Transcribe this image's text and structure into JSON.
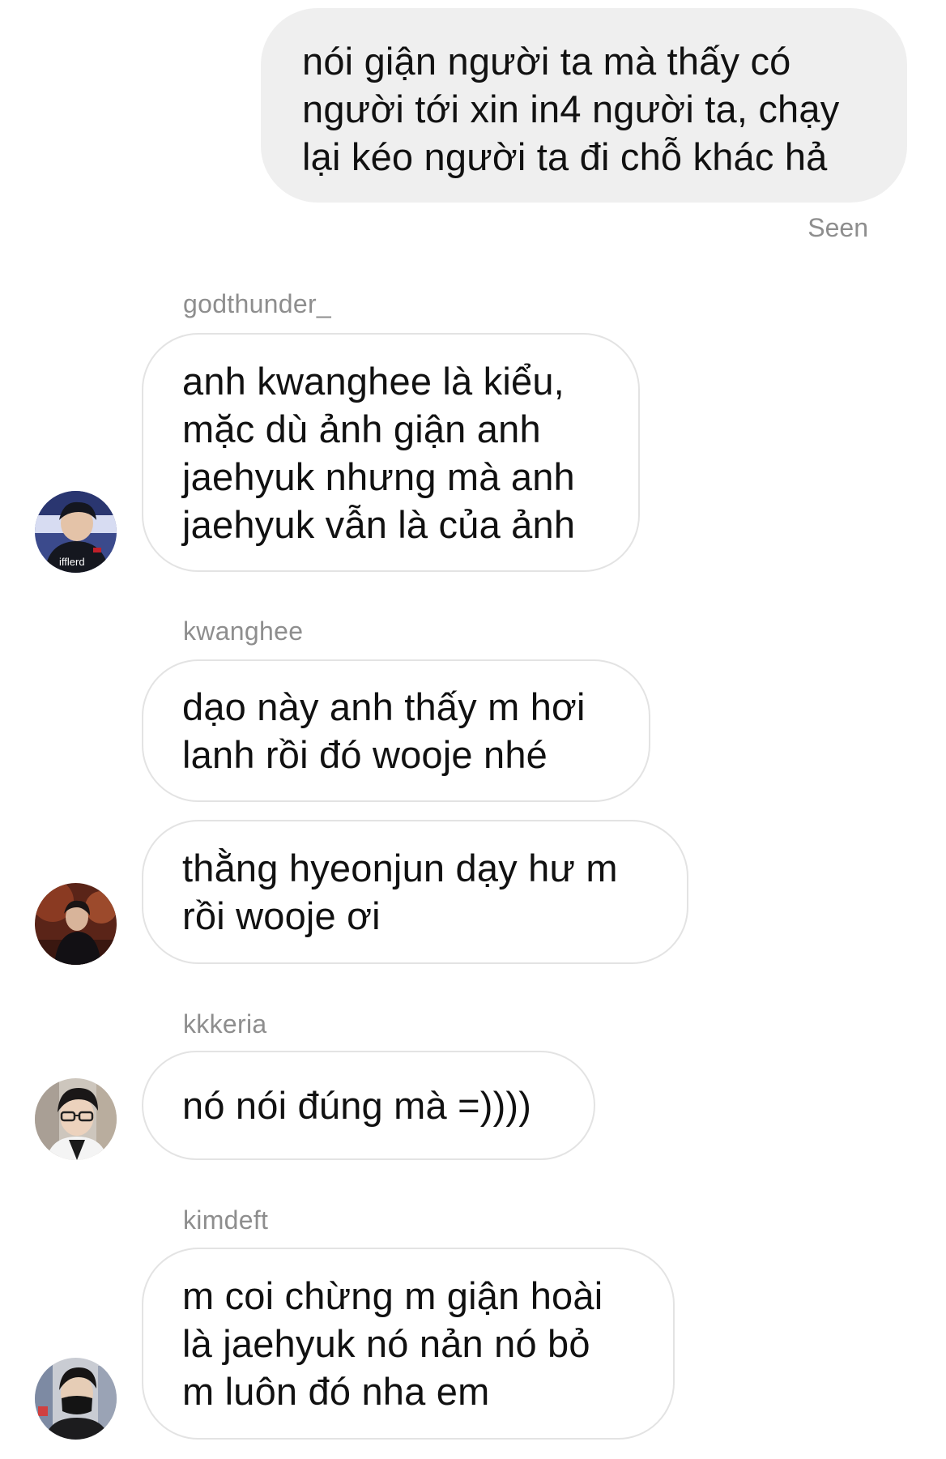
{
  "conversation": {
    "outgoing": {
      "text": "nói giận người ta mà thấy có\nngười tới xin in4 người ta, chạy\nlại kéo người ta đi chỗ khác hả",
      "status": "Seen"
    },
    "groups": [
      {
        "sender": "godthunder_",
        "avatar_icon": "avatar-godthunder-photo",
        "messages": [
          "anh kwanghee là kiểu,\nmặc dù ảnh giận anh\njaehyuk nhưng mà anh\njaehyuk vẫn là của ảnh"
        ],
        "avatar_badge": "ifflerd"
      },
      {
        "sender": "kwanghee",
        "avatar_icon": "avatar-kwanghee-photo",
        "messages": [
          "dạo này anh thấy m hơi\nlanh rồi đó wooje nhé",
          "thằng hyeonjun dạy hư m\nrồi wooje ơi"
        ]
      },
      {
        "sender": "kkkeria",
        "avatar_icon": "avatar-kkkeria-photo",
        "messages": [
          "nó nói đúng mà =))))"
        ]
      },
      {
        "sender": "kimdeft",
        "avatar_icon": "avatar-kimdeft-photo",
        "messages": [
          "m coi chừng m giận hoài\nlà jaehyuk nó nản nó bỏ\nm luôn đó nha em"
        ]
      }
    ]
  },
  "colors": {
    "outgoing_bubble": "#efefef",
    "incoming_border": "#e3e3e3",
    "meta_text": "#8e8e8e",
    "message_text": "#111111"
  }
}
